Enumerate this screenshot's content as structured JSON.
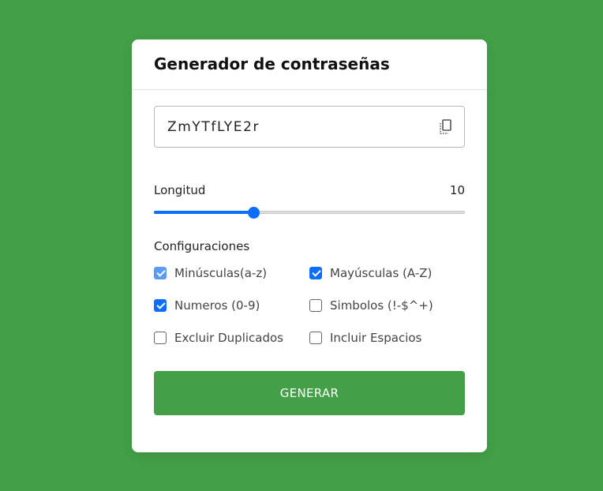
{
  "colors": {
    "background": "#43a047",
    "accent": "#0d6efd",
    "button": "#43a047"
  },
  "header": {
    "title": "Generador de contraseñas"
  },
  "password": {
    "value": "ZmYTfLYE2r",
    "copy_icon": "copy-icon"
  },
  "length": {
    "label": "Longitud",
    "value": "10",
    "fraction": 0.32
  },
  "settings": {
    "title": "Configuraciones",
    "options": [
      {
        "label": "Minúsculas(a-z)",
        "checked": true,
        "disabled": true
      },
      {
        "label": "Mayúsculas (A-Z)",
        "checked": true,
        "disabled": false
      },
      {
        "label": "Numeros (0-9)",
        "checked": true,
        "disabled": false
      },
      {
        "label": "Simbolos (!-$^+)",
        "checked": false,
        "disabled": false
      },
      {
        "label": "Excluir Duplicados",
        "checked": false,
        "disabled": false
      },
      {
        "label": "Incluir Espacios",
        "checked": false,
        "disabled": false
      }
    ]
  },
  "actions": {
    "generate_label": "GENERAR"
  }
}
